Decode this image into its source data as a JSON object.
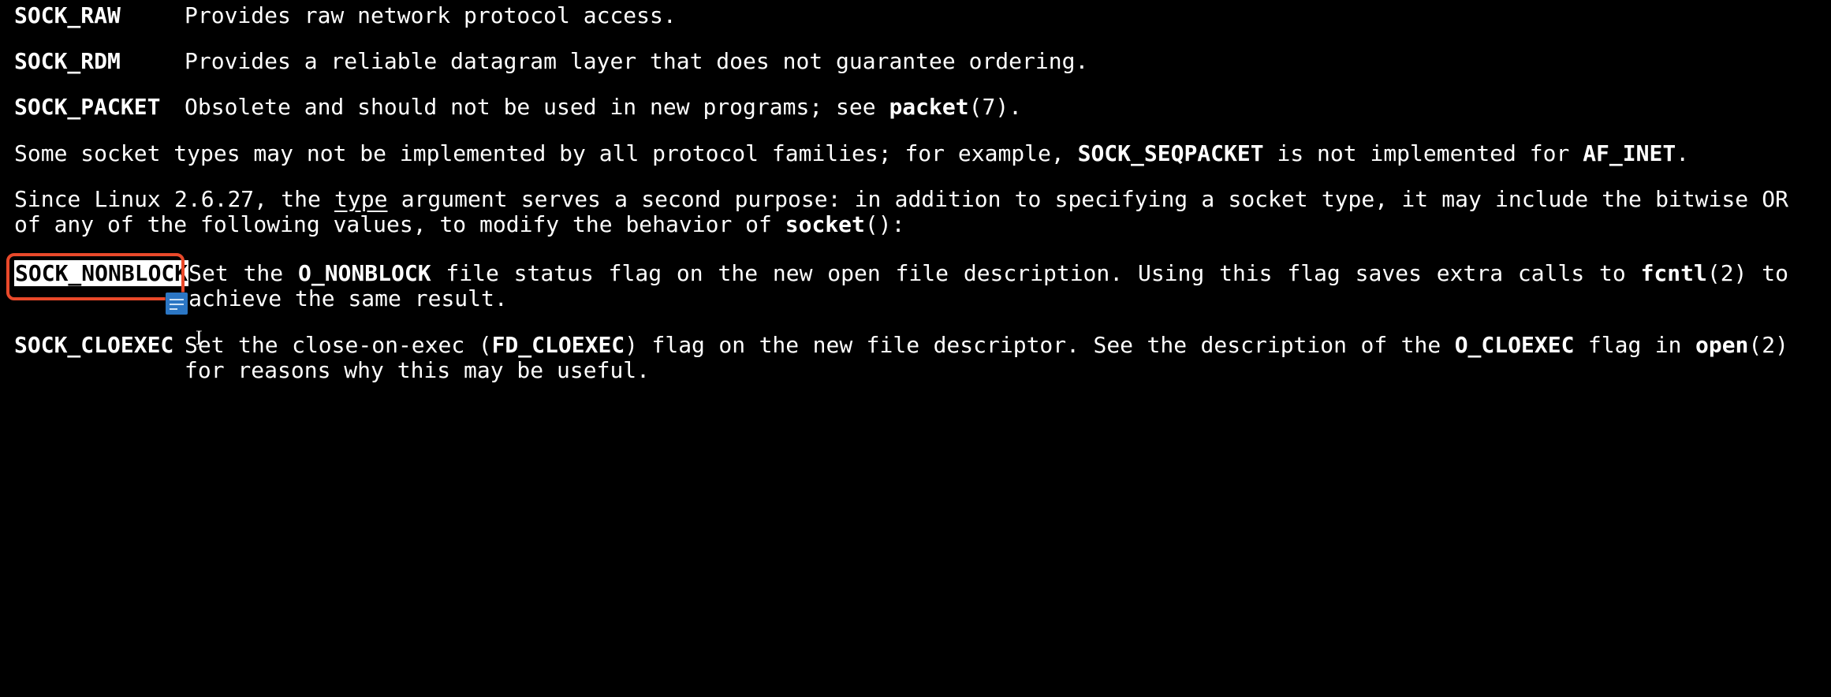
{
  "defs": {
    "sock_raw": {
      "term": "SOCK_RAW",
      "desc_pre": "Provides raw network protocol access."
    },
    "sock_rdm": {
      "term": "SOCK_RDM",
      "desc_pre": "Provides a reliable datagram layer that does not guarantee ordering."
    },
    "sock_packet": {
      "term": "SOCK_PACKET",
      "desc_pre": "Obsolete and should not be used in new programs; see ",
      "bold1": "packet",
      "after1": "(7)."
    },
    "sock_nonblock": {
      "term": "SOCK_NONBLOCK",
      "a": "Set the ",
      "b": "O_NONBLOCK",
      "c": " file status flag on the new open file description.  Using this flag saves extra calls to ",
      "d": "fcntl",
      "e": "(2) to achieve the same result."
    },
    "sock_cloexec": {
      "term": "SOCK_CLOEXEC",
      "a": "Set the close-on-exec (",
      "b": "FD_CLOEXEC",
      "c": ") flag on the  new  file  descriptor.   See  the  description  of the ",
      "d": "O_CLOEXEC",
      "e": " flag in ",
      "f": "open",
      "g": "(2) for reasons why this may be useful."
    }
  },
  "para1": {
    "a": "Some socket types may not be implemented by all protocol families; for example, ",
    "b": "SOCK_SEQPACKET",
    "c": " is not implemented for ",
    "d": "AF_INET",
    "e": "."
  },
  "para2": {
    "a": "Since Linux 2.6.27, the ",
    "b": "type",
    "c": " argument serves a second purpose: in addition to specifying a socket type, it may include the bitwise OR of any of the following values, to  modify  the  behavior  of  ",
    "d": "socket",
    "e": "():"
  },
  "annotations": {
    "highlight_box_color": "#e9492a",
    "highlighted_term": "SOCK_NONBLOCK",
    "note_icon_color": "#2b76c4"
  }
}
